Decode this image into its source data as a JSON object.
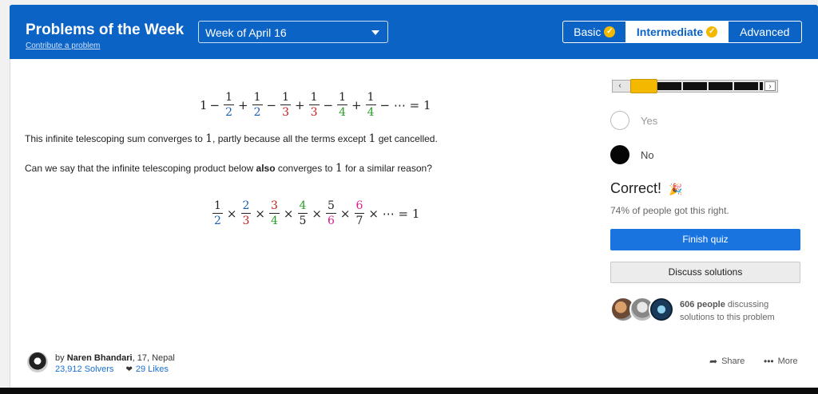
{
  "header": {
    "title": "Problems of the Week",
    "contribute_link": "Contribute a problem",
    "week_select": "Week of April 16",
    "levels": [
      {
        "label": "Basic",
        "completed": true,
        "active": false
      },
      {
        "label": "Intermediate",
        "completed": true,
        "active": true
      },
      {
        "label": "Advanced",
        "completed": false,
        "active": false
      }
    ]
  },
  "problem": {
    "eq1_lead": "1",
    "eq1_tail": "− ⋯ = 1",
    "eq1_terms": [
      {
        "op": "−",
        "num": "1",
        "den": "2",
        "color": "blue"
      },
      {
        "op": "+",
        "num": "1",
        "den": "2",
        "color": "blue"
      },
      {
        "op": "−",
        "num": "1",
        "den": "3",
        "color": "red"
      },
      {
        "op": "+",
        "num": "1",
        "den": "3",
        "color": "red"
      },
      {
        "op": "−",
        "num": "1",
        "den": "4",
        "color": "green"
      },
      {
        "op": "+",
        "num": "1",
        "den": "4",
        "color": "green"
      }
    ],
    "text1_a": "This infinite telescoping sum converges to ",
    "text1_m1": "1",
    "text1_b": ", partly because all the terms except ",
    "text1_m2": "1",
    "text1_c": " get cancelled.",
    "text2_a": "Can we say that the infinite telescoping product below ",
    "text2_bold": "also",
    "text2_b": " converges to ",
    "text2_m": "1",
    "text2_c": " for a similar reason?",
    "eq2_tail": "× ⋯ = 1",
    "eq2_terms": [
      {
        "num": "1",
        "den": "2",
        "num_color": "default",
        "den_color": "blue"
      },
      {
        "num": "2",
        "den": "3",
        "num_color": "blue",
        "den_color": "red"
      },
      {
        "num": "3",
        "den": "4",
        "num_color": "red",
        "den_color": "green"
      },
      {
        "num": "4",
        "den": "5",
        "num_color": "green",
        "den_color": "default"
      },
      {
        "num": "5",
        "den": "6",
        "num_color": "default",
        "den_color": "magenta"
      },
      {
        "num": "6",
        "den": "7",
        "num_color": "magenta",
        "den_color": "default"
      }
    ]
  },
  "answer": {
    "options": [
      {
        "label": "Yes",
        "selected": false
      },
      {
        "label": "No",
        "selected": true
      }
    ],
    "result": "Correct!",
    "result_icon": "party-popper-icon",
    "percent_text": "74% of people got this right.",
    "finish_button": "Finish quiz",
    "discuss_button": "Discuss solutions",
    "discussing_count": "606 people",
    "discussing_text": " discussing solutions to this problem"
  },
  "footer": {
    "by_prefix": "by ",
    "author": "Naren Bhandari",
    "author_info": ", 17, Nepal",
    "solvers": "23,912 Solvers",
    "likes": "29 Likes",
    "share_label": "Share",
    "more_label": "More"
  },
  "colors": {
    "header_blue": "#0b63c5",
    "accent_yellow": "#f5b800",
    "finish_blue": "#1a74e0",
    "blue": "#1a5fb4",
    "red": "#cc1d1d",
    "green": "#2a9d2a",
    "magenta": "#d81b8a"
  }
}
